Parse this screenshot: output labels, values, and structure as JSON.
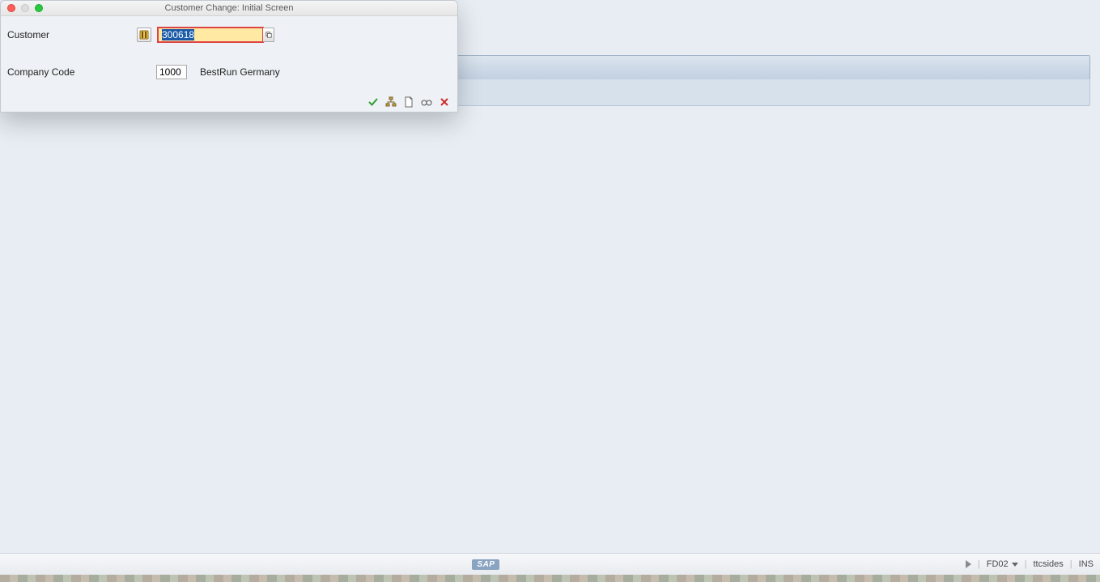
{
  "dialog": {
    "title": "Customer Change: Initial Screen",
    "customer_label": "Customer",
    "customer_value": "300618",
    "company_code_label": "Company Code",
    "company_code_value": "1000",
    "company_code_name": "BestRun Germany"
  },
  "statusbar": {
    "logo": "SAP",
    "tcode": "FD02",
    "session": "ttcsides",
    "insert_mode": "INS"
  }
}
